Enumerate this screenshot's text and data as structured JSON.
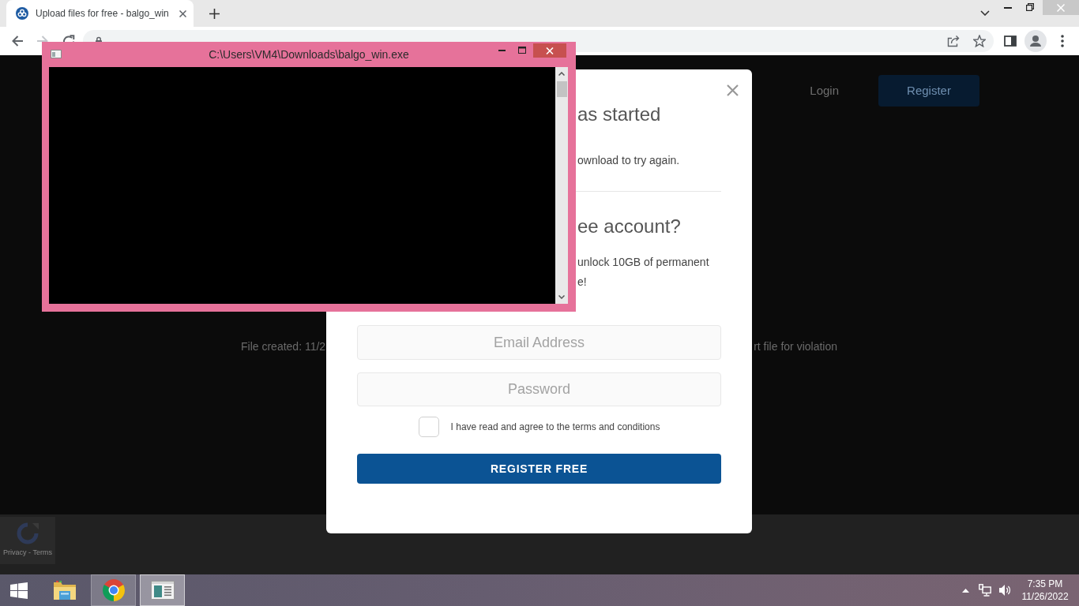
{
  "browser": {
    "tabs": [
      {
        "title": "Upload files for free - balgo_win",
        "selected": true
      }
    ]
  },
  "page": {
    "nav": [
      {
        "label": "Login",
        "kind": "link"
      },
      {
        "label": "Register",
        "kind": "button"
      }
    ],
    "file_info": [
      "File created: 11/2",
      "rt file for violation"
    ],
    "recaptcha": {
      "links": "Privacy - Terms"
    }
  },
  "modal": {
    "title": "as started",
    "message": "ownload to try again.",
    "signup_title": "ee account?",
    "signup_text": [
      "unlock 10GB of permanent",
      "e!"
    ],
    "fields": [
      {
        "placeholder": "Email Address"
      },
      {
        "placeholder": "Password"
      }
    ],
    "terms": {
      "label": "I have read and agree to the terms and conditions",
      "checked": false
    },
    "submit": "REGISTER FREE"
  },
  "console_window": {
    "title": "C:\\Users\\VM4\\Downloads\\balgo_win.exe"
  },
  "taskbar": {
    "apps": [
      {
        "kind": "explorer",
        "running": false,
        "selected": false
      },
      {
        "kind": "chrome",
        "running": true,
        "selected": false
      },
      {
        "kind": "console",
        "running": true,
        "selected": true
      }
    ],
    "clock": {
      "time": "7:35 PM",
      "date": "11/26/2022"
    }
  }
}
